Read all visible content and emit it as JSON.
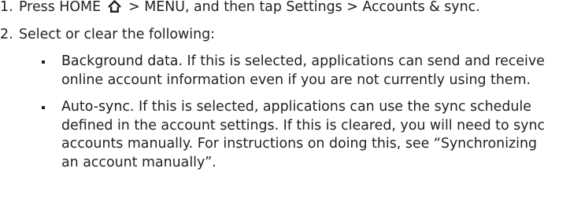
{
  "steps": [
    {
      "number": "1.",
      "parts": {
        "a": "Press HOME",
        "home_icon": "home-icon",
        "b": " > MENU, and then tap ",
        "c": "Settings > Accounts & sync",
        "d": "."
      }
    },
    {
      "number": "2.",
      "text": "Select or clear the following:",
      "bullets": [
        {
          "term": "Background data",
          "body": ". If this is selected, applications can send and receive online account information even if you are not currently using them."
        },
        {
          "term": "Auto-sync",
          "body": ". If this is selected, applications can use the sync schedule defined in the account settings. If this is cleared, you will need to sync accounts manually. For instructions on doing this, see “Synchronizing an account manually”."
        }
      ]
    }
  ]
}
